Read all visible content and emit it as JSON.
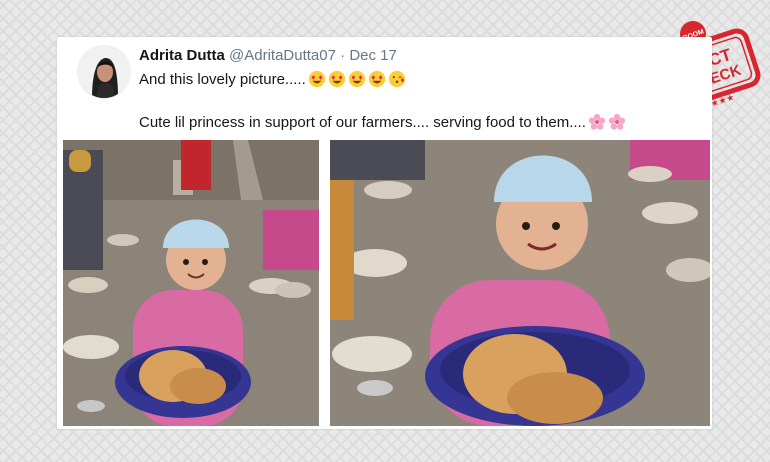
{
  "tweet": {
    "display_name": "Adrita Dutta",
    "handle": "@AdritaDutta07",
    "separator": "·",
    "date": "Dec 17",
    "line1_text": "And this lovely picture.....",
    "line1_emojis": [
      "heart-eyes-emoji",
      "heart-eyes-emoji",
      "heart-eyes-emoji",
      "heart-eyes-emoji",
      "kissing-face-emoji"
    ],
    "line2_text": "Cute lil princess in support of our farmers.... serving food to them....",
    "line2_emojis": [
      "cherry-blossom-emoji",
      "cherry-blossom-emoji"
    ]
  },
  "stamp": {
    "top_text": "BOOM",
    "line1": "FACT",
    "line2": "CHECK",
    "stars": "★★★"
  },
  "colors": {
    "stamp_red": "#d7262e",
    "text_primary": "#14171a",
    "text_secondary": "#657786"
  }
}
